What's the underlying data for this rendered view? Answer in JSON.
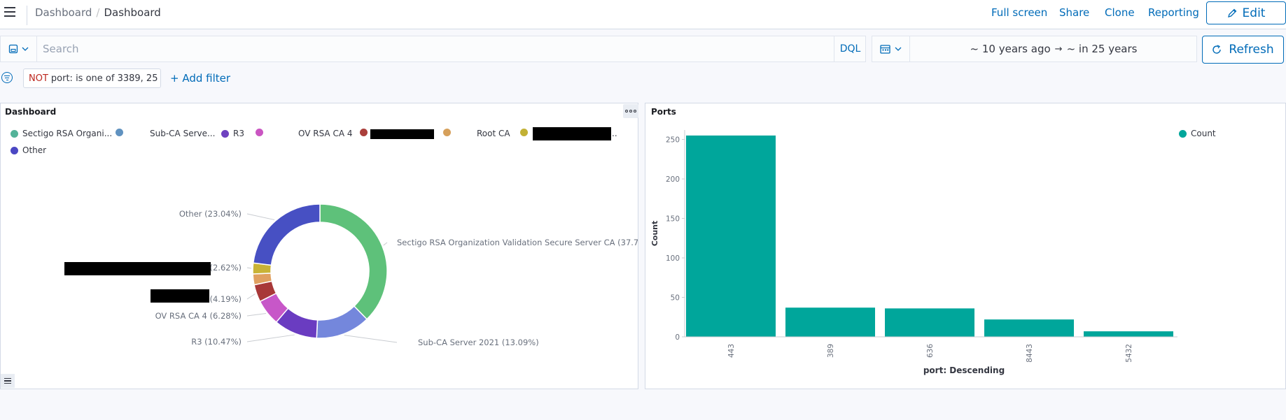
{
  "header": {
    "breadcrumbs": [
      "Dashboard",
      "Dashboard"
    ],
    "links": [
      "Full screen",
      "Share",
      "Clone",
      "Reporting"
    ],
    "edit_label": "Edit"
  },
  "query": {
    "placeholder": "Search",
    "language": "DQL",
    "date_start": "~ 10 years ago",
    "date_arrow": "→",
    "date_end": "~ in 25 years",
    "refresh_label": "Refresh"
  },
  "filters": {
    "pill_negate": "NOT",
    "pill_text": "port: is one of 3389, 25",
    "add_filter": "+ Add filter"
  },
  "panels": {
    "left_title": "Dashboard",
    "right_title": "Ports"
  },
  "pie_legend": [
    {
      "label": "Sectigo RSA Organi...",
      "color": "#54b399"
    },
    {
      "label": "Sub-CA Serve...",
      "color": "#6092c0"
    },
    {
      "label": "R3",
      "color": "#6e41c0"
    },
    {
      "label": "OV RSA CA 4",
      "color": "#ca55c2"
    },
    {
      "label": "",
      "color": "#aa3f3b"
    },
    {
      "label": "Root CA",
      "color": "#d6a05b"
    },
    {
      "label": "..",
      "color": "#c2b135"
    },
    {
      "label": "Other",
      "color": "#4b47c3"
    }
  ],
  "chart_data": [
    {
      "type": "pie",
      "title": "",
      "labels": [
        "Sectigo RSA Organization Validation Secure Server CA (37.7",
        "Sub-CA Server 2021 (13.09%)",
        "R3 (10.47%)",
        "OV RSA CA 4 (6.28%)",
        "(4.19%)",
        "",
        "(2.62%)",
        "Other (23.04%)"
      ],
      "values": [
        37.7,
        13.09,
        10.47,
        6.28,
        4.19,
        2.61,
        2.62,
        23.04
      ],
      "colors": [
        "#5ec17a",
        "#7487dc",
        "#6a3cc1",
        "#c757c8",
        "#a83838",
        "#e0a060",
        "#c9b336",
        "#4750c3"
      ]
    },
    {
      "type": "bar",
      "title": "",
      "categories": [
        "443",
        "389",
        "636",
        "8443",
        "5432"
      ],
      "values": [
        255,
        37,
        36,
        22,
        7
      ],
      "series_name": "Count",
      "color": "#00a69b",
      "xlabel": "port: Descending",
      "ylabel": "Count",
      "yticks": [
        0,
        50,
        100,
        150,
        200,
        250
      ],
      "ylim": [
        0,
        262
      ]
    }
  ]
}
